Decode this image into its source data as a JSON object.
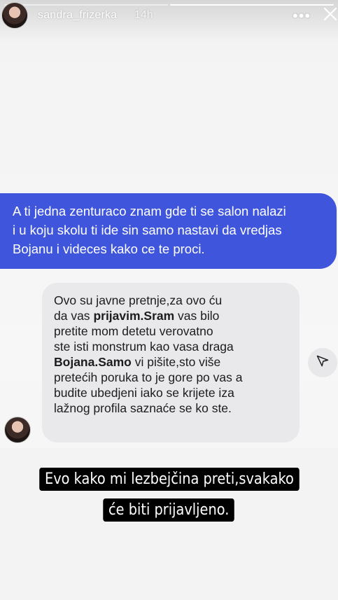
{
  "story": {
    "progress_segments": 2,
    "active_segment": 1,
    "username": "sandra_frizerka",
    "time": "14h",
    "more_icon": "more-horizontal-icon",
    "close_icon": "close-icon"
  },
  "sent_message": {
    "lines": [
      "A ti jedna zenturaco znam gde ti se salon nalazi",
      "i u koju skolu ti ide sin samo nastavi da vredjas",
      "Bojanu i videces kako ce te proci."
    ],
    "color": "#3f56dc"
  },
  "received_message": {
    "l1": "Ovo su javne pretnje,za ovo ću",
    "l2a": "da vas ",
    "l2b": "prijavim.Sram",
    "l2c": " vas bilo",
    "l3": "pretite mom detetu verovatno",
    "l4": "ste isti monstrum kao vasa draga",
    "l5a": "Bojana.Samo",
    "l5b": " vi pišite,sto više",
    "l6": "pretećih poruka to je gore po vas a",
    "l7": "budite ubedjeni iako se krijete iza",
    "l8": "lažnog profila saznaće se ko ste."
  },
  "caption": {
    "line1": "Evo kako mi lezbejčina preti,svakako",
    "line2": "će biti prijavljeno."
  },
  "share_icon": "send-icon"
}
